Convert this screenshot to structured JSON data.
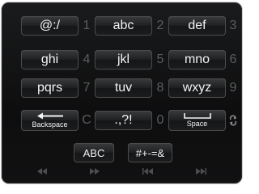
{
  "keypad": {
    "rows": [
      {
        "key_label": [
          "@:/",
          "abc",
          "def"
        ],
        "digit": [
          "1",
          "2",
          "3"
        ]
      },
      {
        "key_label": [
          "ghi",
          "jkl",
          "mno"
        ],
        "digit": [
          "4",
          "5",
          "6"
        ]
      },
      {
        "key_label": [
          "pqrs",
          "tuv",
          "wxyz"
        ],
        "digit": [
          "7",
          "8",
          "9"
        ]
      }
    ],
    "backspace_label": "Backspace",
    "clear_digit": "C",
    "punct_label": ".,?!",
    "zero_digit": "0",
    "space_label": "Space",
    "abc_label": "ABC",
    "symbols_label": "#+-=&"
  },
  "icons": {
    "backspace": "left-arrow-icon",
    "space": "space-bracket-icon",
    "toggle": "cycle-arrows-icon",
    "rewind": "rewind-icon",
    "fast_forward": "fast-forward-icon",
    "prev": "skip-previous-icon",
    "next": "skip-next-icon"
  },
  "colors": {
    "key_text": "#f4f4f4",
    "digit_text": "#5c5d5f",
    "background": "#111112"
  }
}
